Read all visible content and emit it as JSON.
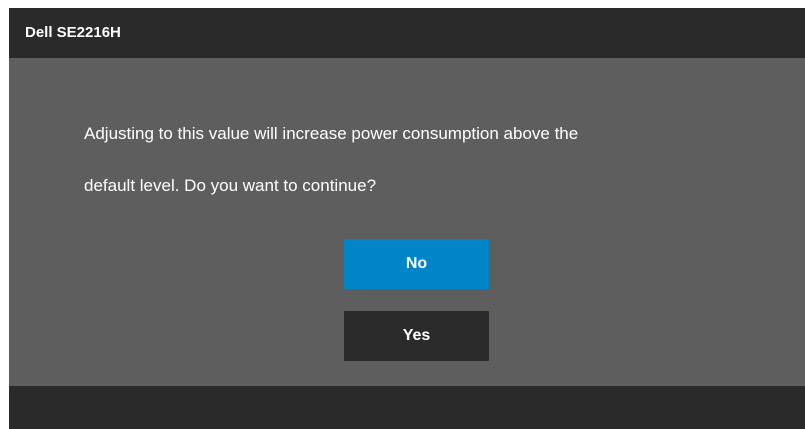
{
  "header": {
    "title": "Dell SE2216H"
  },
  "dialog": {
    "message_line1": "Adjusting to this value will increase power consumption above the",
    "message_line2": "default level. Do you want to continue?",
    "no_label": "No",
    "yes_label": "Yes"
  },
  "colors": {
    "panel": "#5e5e5e",
    "bar": "#2a2a2a",
    "selected": "#0086c8",
    "button": "#2b2b2b",
    "text": "#ffffff"
  }
}
